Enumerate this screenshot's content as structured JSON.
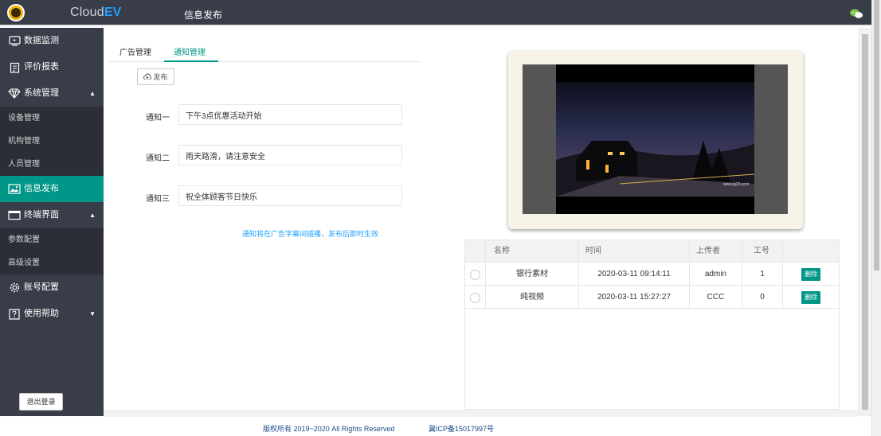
{
  "header": {
    "brand_prefix": "Cloud",
    "brand_suffix": "EV",
    "title": "信息发布"
  },
  "sidebar": {
    "items": [
      {
        "label": "数据监测",
        "type": "item"
      },
      {
        "label": "评价报表",
        "type": "item"
      },
      {
        "label": "系统管理",
        "type": "group",
        "expanded": true
      },
      {
        "label": "设备管理",
        "type": "sub"
      },
      {
        "label": "机构管理",
        "type": "sub"
      },
      {
        "label": "人员管理",
        "type": "sub"
      },
      {
        "label": "信息发布",
        "type": "item",
        "active": true
      },
      {
        "label": "终端界面",
        "type": "group",
        "expanded": true
      },
      {
        "label": "参数配置",
        "type": "sub"
      },
      {
        "label": "高级设置",
        "type": "sub"
      },
      {
        "label": "账号配置",
        "type": "item"
      },
      {
        "label": "使用帮助",
        "type": "group",
        "expanded": false
      }
    ],
    "logout": "退出登录"
  },
  "tabs": [
    {
      "label": "广告管理",
      "active": false
    },
    {
      "label": "通知管理",
      "active": true
    }
  ],
  "publish_button": "发布",
  "notices": [
    {
      "label": "通知一",
      "value": "下午3点优惠活动开始"
    },
    {
      "label": "通知二",
      "value": "雨天路滑，请注意安全"
    },
    {
      "label": "通知三",
      "value": "祝全体顾客节日快乐"
    }
  ],
  "hint": "通知将在广告字幕间插播，发布后即时生效",
  "photo_watermark": "www.jq23.com",
  "table": {
    "headers": [
      "名称",
      "时间",
      "上传者",
      "工号"
    ],
    "rows": [
      {
        "name": "银行素材",
        "time": "2020-03-11 09:14:11",
        "uploader": "admin",
        "id": "1",
        "action": "删除"
      },
      {
        "name": "纯视频",
        "time": "2020-03-11 15:27:27",
        "uploader": "CCC",
        "id": "0",
        "action": "删除"
      }
    ]
  },
  "footer": {
    "copyright": "版权所有 2019~2020 All Rights Reserved",
    "icp": "冀ICP备15017997号"
  },
  "colors": {
    "topbar": "#393d49",
    "accent": "#009688",
    "link": "#1e9fff"
  }
}
